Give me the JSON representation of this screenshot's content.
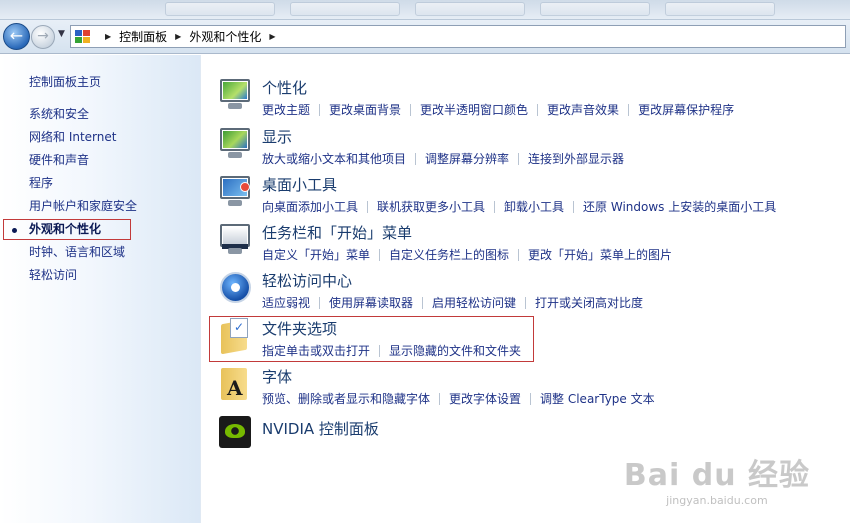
{
  "address_bar": {
    "crumbs": [
      "控制面板",
      "外观和个性化"
    ]
  },
  "sidebar": {
    "home": "控制面板主页",
    "items": [
      {
        "label": "系统和安全"
      },
      {
        "label": "网络和 Internet"
      },
      {
        "label": "硬件和声音"
      },
      {
        "label": "程序"
      },
      {
        "label": "用户帐户和家庭安全"
      },
      {
        "label": "外观和个性化",
        "current": true
      },
      {
        "label": "时钟、语言和区域"
      },
      {
        "label": "轻松访问"
      }
    ]
  },
  "categories": [
    {
      "title": "个性化",
      "icon": "personalization-icon",
      "links": [
        "更改主题",
        "更改桌面背景",
        "更改半透明窗口颜色",
        "更改声音效果",
        "更改屏幕保护程序"
      ]
    },
    {
      "title": "显示",
      "icon": "display-icon",
      "links": [
        "放大或缩小文本和其他项目",
        "调整屏幕分辨率",
        "连接到外部显示器"
      ]
    },
    {
      "title": "桌面小工具",
      "icon": "gadgets-icon",
      "links": [
        "向桌面添加小工具",
        "联机获取更多小工具",
        "卸载小工具",
        "还原 Windows 上安装的桌面小工具"
      ]
    },
    {
      "title": "任务栏和「开始」菜单",
      "icon": "taskbar-icon",
      "links": [
        "自定义「开始」菜单",
        "自定义任务栏上的图标",
        "更改「开始」菜单上的图片"
      ]
    },
    {
      "title": "轻松访问中心",
      "icon": "ease-of-access-icon",
      "links": [
        "适应弱视",
        "使用屏幕读取器",
        "启用轻松访问键",
        "打开或关闭高对比度"
      ]
    },
    {
      "title": "文件夹选项",
      "icon": "folder-options-icon",
      "links": [
        "指定单击或双击打开",
        "显示隐藏的文件和文件夹"
      ]
    },
    {
      "title": "字体",
      "icon": "fonts-icon",
      "links": [
        "预览、删除或者显示和隐藏字体",
        "更改字体设置",
        "调整 ClearType 文本"
      ]
    },
    {
      "title": "NVIDIA 控制面板",
      "icon": "nvidia-icon",
      "links": []
    }
  ],
  "watermark": {
    "main": "Bai du 经验",
    "sub": "jingyan.baidu.com"
  },
  "colors": {
    "link": "#1e3287",
    "title": "#1a3c6e",
    "highlight": "#c23a3a"
  }
}
